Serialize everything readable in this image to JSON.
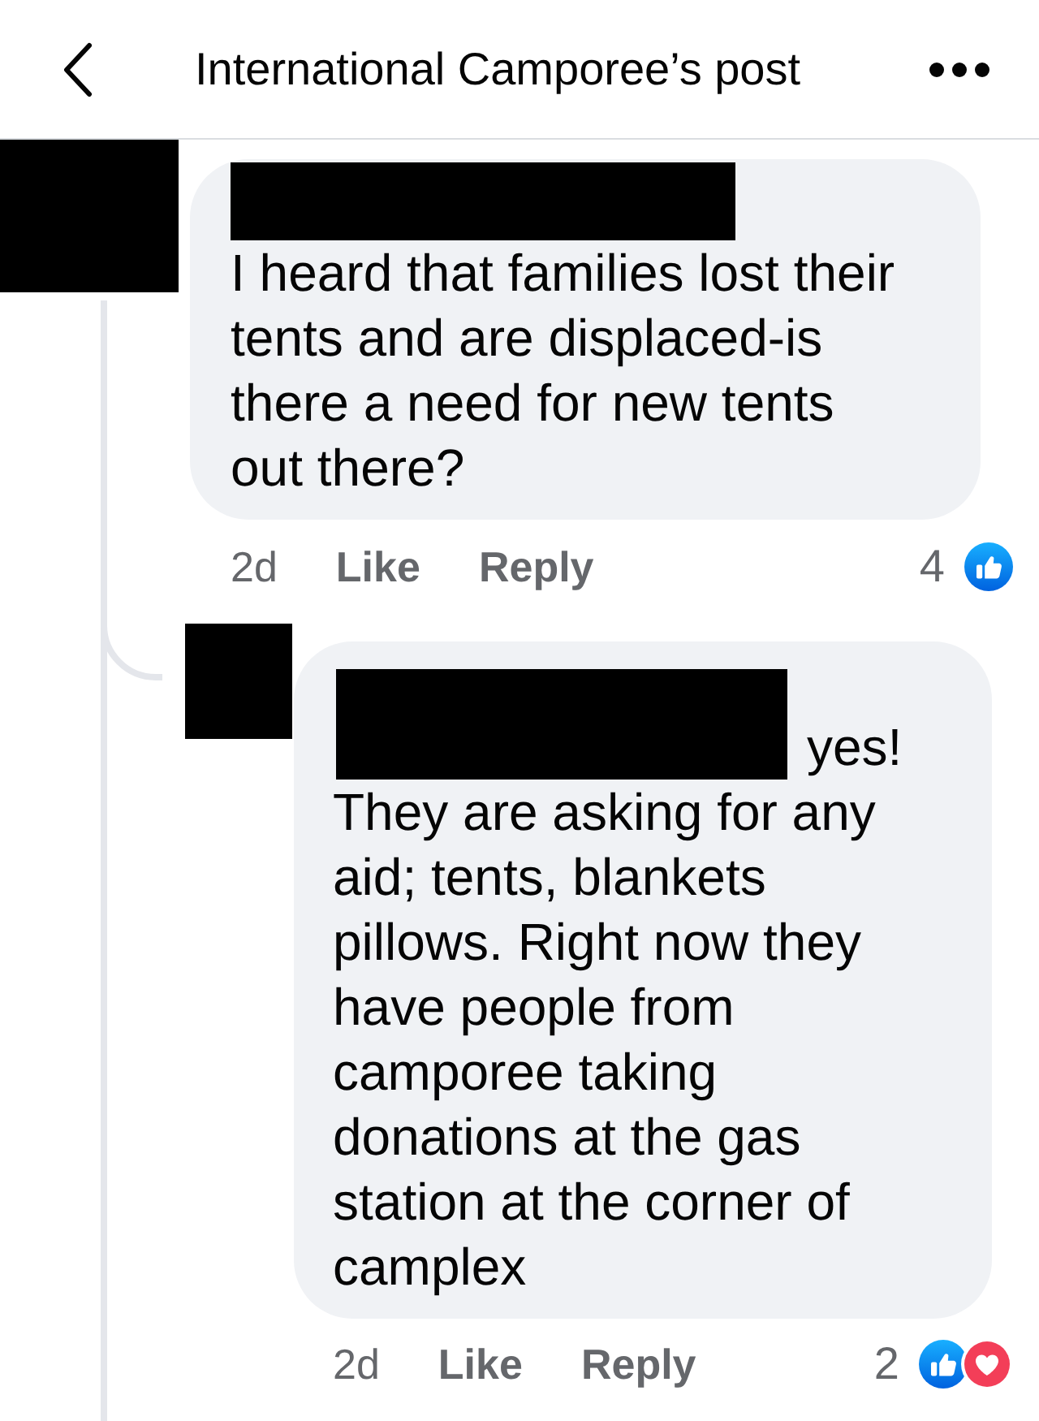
{
  "header": {
    "title": "International Camporee’s post"
  },
  "comments": [
    {
      "text": "I heard that families lost their tents and are displaced-is there a need for new tents out there?",
      "time": "2d",
      "actions": [
        "Like",
        "Reply"
      ],
      "reaction_count": "4",
      "reactions": [
        {
          "kind": "like"
        }
      ],
      "replies": [
        {
          "lead_text": "yes!",
          "text": "They are asking for any aid; tents, blankets pillows. Right now they have people from camporee taking donations at the gas station at the corner of camplex",
          "time": "2d",
          "actions": [
            "Like",
            "Reply"
          ],
          "reaction_count": "2",
          "reactions": [
            {
              "kind": "like"
            },
            {
              "kind": "love"
            }
          ]
        }
      ]
    }
  ]
}
